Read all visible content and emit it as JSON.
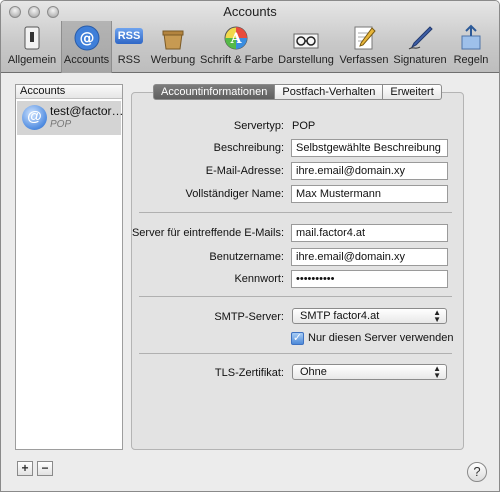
{
  "window": {
    "title": "Accounts"
  },
  "toolbar": {
    "items": [
      {
        "label": "Allgemein",
        "icon": "switch-icon"
      },
      {
        "label": "Accounts",
        "icon": "at-sign-icon"
      },
      {
        "label": "RSS",
        "icon": "rss-icon"
      },
      {
        "label": "Werbung",
        "icon": "junk-mail-icon"
      },
      {
        "label": "Schrift & Farbe",
        "icon": "color-wheel-icon"
      },
      {
        "label": "Darstellung",
        "icon": "glasses-icon"
      },
      {
        "label": "Verfassen",
        "icon": "pencil-paper-icon"
      },
      {
        "label": "Signaturen",
        "icon": "fountain-pen-icon"
      },
      {
        "label": "Regeln",
        "icon": "rules-icon"
      }
    ],
    "rss_badge": "RSS"
  },
  "sidebar": {
    "header": "Accounts",
    "account": {
      "name": "test@factor…",
      "type": "POP",
      "icon_glyph": "@"
    },
    "add_label": "+",
    "remove_label": "−"
  },
  "tabs": [
    {
      "label": "Accountinformationen",
      "active": true
    },
    {
      "label": "Postfach-Verhalten",
      "active": false
    },
    {
      "label": "Erweitert",
      "active": false
    }
  ],
  "form": {
    "servertyp_label": "Servertyp:",
    "servertyp_value": "POP",
    "beschreibung_label": "Beschreibung:",
    "beschreibung_value": "Selbstgewählte Beschreibung",
    "email_label": "E-Mail-Adresse:",
    "email_value": "ihre.email@domain.xy",
    "name_label": "Vollständiger Name:",
    "name_value": "Max Mustermann",
    "incoming_label": "Server für eintreffende E-Mails:",
    "incoming_value": "mail.factor4.at",
    "user_label": "Benutzername:",
    "user_value": "ihre.email@domain.xy",
    "password_label": "Kennwort:",
    "password_value": "••••••••••",
    "smtp_label": "SMTP-Server:",
    "smtp_value": "SMTP factor4.at",
    "only_server_label": "Nur diesen Server verwenden",
    "only_server_checked": true,
    "tls_label": "TLS-Zertifikat:",
    "tls_value": "Ohne"
  },
  "help_label": "?",
  "colors": {
    "accent_blue": "#4e8ad8",
    "selected_tab": "#6a6a6a"
  }
}
